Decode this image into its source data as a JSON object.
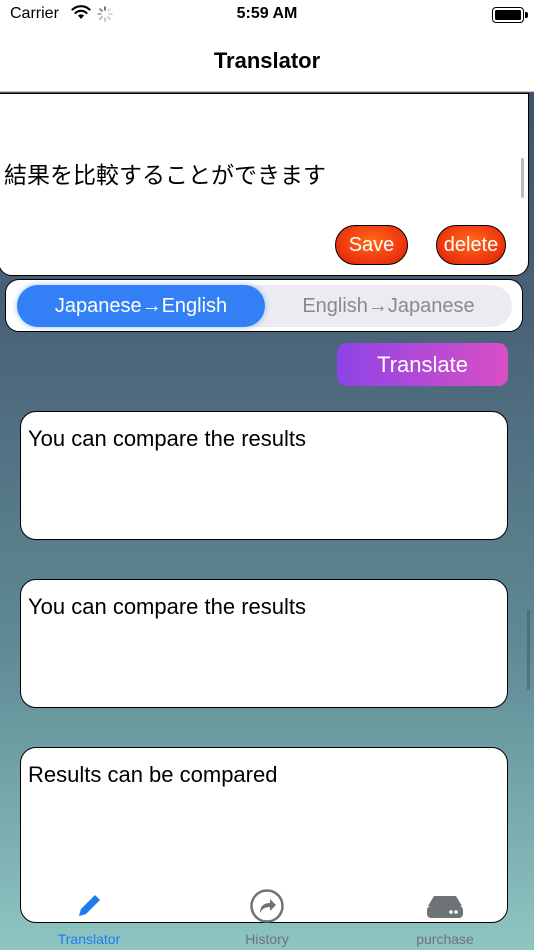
{
  "status_bar": {
    "carrier": "Carrier",
    "time": "5:59 AM"
  },
  "nav": {
    "title": "Translator"
  },
  "input": {
    "text": "結果を比較することができます",
    "save_label": "Save",
    "delete_label": "delete"
  },
  "segment": {
    "options": [
      "Japanese→English",
      "English→Japanese"
    ],
    "selected": 0
  },
  "translate_label": "Translate",
  "results": [
    "You can compare the results",
    "You can compare the results",
    "Results can be compared"
  ],
  "tabs": [
    {
      "label": "Translator",
      "icon": "pencil-icon"
    },
    {
      "label": "History",
      "icon": "share-arrow-icon"
    },
    {
      "label": "purchase",
      "icon": "hard-drive-icon"
    }
  ],
  "colors": {
    "accent": "#3380f6",
    "tab_active": "#1e7bf0",
    "button_orange": "#f03a10",
    "translate_purple": "#8e44e6",
    "translate_pink": "#d94fc5"
  }
}
